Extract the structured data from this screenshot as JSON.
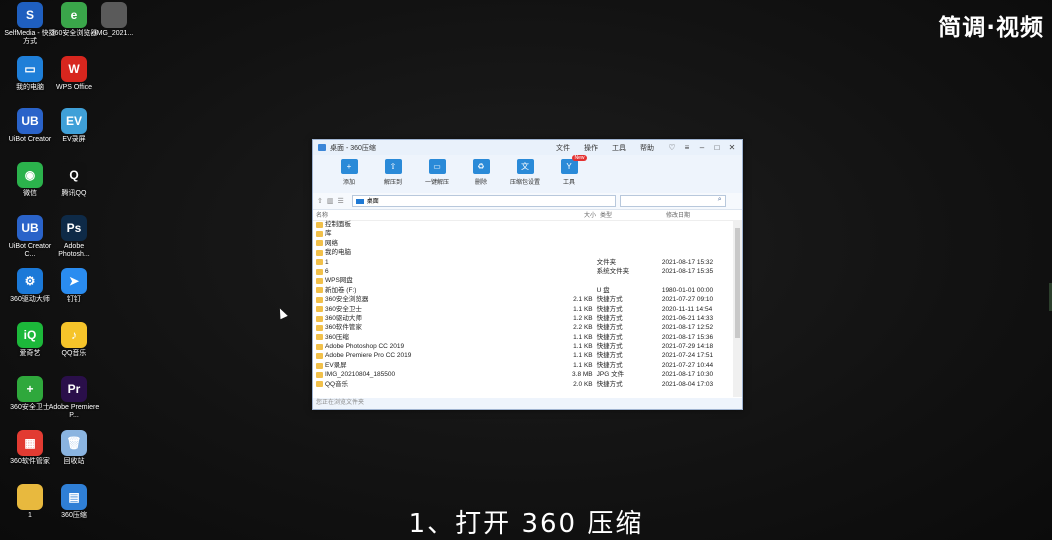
{
  "watermark": "简调·视频",
  "subtitle": "1、打开 360 压缩",
  "desktop_icons": [
    {
      "label": "SelfMedia - 快捷方式",
      "color": "#1f5fbf",
      "glyph": "S",
      "icon": "selfmedia-icon"
    },
    {
      "label": "360安全浏览器",
      "color": "#3aa64a",
      "glyph": "e",
      "icon": "browser-icon"
    },
    {
      "label": "IMG_2021...",
      "color": "#5a5a5a",
      "glyph": "",
      "icon": "image-thumbnail-icon"
    },
    {
      "label": "我的电脑",
      "color": "#1f7fd8",
      "glyph": "▭",
      "icon": "computer-icon"
    },
    {
      "label": "WPS Office",
      "color": "#d7261e",
      "glyph": "W",
      "icon": "wps-icon"
    },
    {
      "label": "UiBot Creator",
      "color": "#2a63c9",
      "glyph": "UB",
      "icon": "uibot-icon"
    },
    {
      "label": "EV录屏",
      "color": "#3fa0d8",
      "glyph": "EV",
      "icon": "ev-recorder-icon"
    },
    {
      "label": "微信",
      "color": "#2bb24c",
      "glyph": "◉",
      "icon": "wechat-icon"
    },
    {
      "label": "腾讯QQ",
      "color": "#111111",
      "glyph": "Q",
      "icon": "qq-icon"
    },
    {
      "label": "UiBot Creator C...",
      "color": "#2a63c9",
      "glyph": "UB",
      "icon": "uibot-icon"
    },
    {
      "label": "Adobe Photosh...",
      "color": "#0e2a47",
      "glyph": "Ps",
      "icon": "photoshop-icon"
    },
    {
      "label": "360驱动大师",
      "color": "#1b79d8",
      "glyph": "⚙",
      "icon": "driver-icon"
    },
    {
      "label": "钉钉",
      "color": "#2a8cf0",
      "glyph": "➤",
      "icon": "dingtalk-icon"
    },
    {
      "label": "爱奇艺",
      "color": "#1cb83a",
      "glyph": "iQ",
      "icon": "iqiyi-icon"
    },
    {
      "label": "QQ音乐",
      "color": "#f6c42a",
      "glyph": "♪",
      "icon": "qqmusic-icon"
    },
    {
      "label": "360安全卫士",
      "color": "#2fa83c",
      "glyph": "+",
      "icon": "security-icon"
    },
    {
      "label": "Adobe Premiere P...",
      "color": "#2a0f4a",
      "glyph": "Pr",
      "icon": "premiere-icon"
    },
    {
      "label": "360软件管家",
      "color": "#e23b32",
      "glyph": "▦",
      "icon": "software-manager-icon"
    },
    {
      "label": "回收站",
      "color": "#8ab4e0",
      "glyph": "🗑",
      "icon": "recycle-bin-icon"
    },
    {
      "label": "1",
      "color": "#e8b93e",
      "glyph": "",
      "icon": "folder-icon"
    },
    {
      "label": "360压缩",
      "color": "#2f7fd6",
      "glyph": "▤",
      "icon": "compress-icon"
    }
  ],
  "window": {
    "title": "桌面 - 360压缩",
    "menu": [
      "文件",
      "操作",
      "工具",
      "帮助"
    ],
    "toolbar": [
      {
        "label": "添加",
        "icon": "add-icon",
        "glyph": "+"
      },
      {
        "label": "解压到",
        "icon": "extract-to-icon",
        "glyph": "⇧"
      },
      {
        "label": "一键解压",
        "icon": "one-click-extract-icon",
        "glyph": "▭"
      },
      {
        "label": "删除",
        "icon": "delete-icon",
        "glyph": "♻"
      },
      {
        "label": "压缩包设置",
        "icon": "archive-settings-icon",
        "glyph": "文"
      },
      {
        "label": "工具",
        "icon": "tools-icon",
        "glyph": "Y",
        "badge": "New"
      }
    ],
    "address": "桌面",
    "columns": {
      "name": "名称",
      "size": "大小",
      "type": "类型",
      "date": "修改日期"
    },
    "rows": [
      {
        "name": "控制面板",
        "size": "",
        "type": "",
        "date": ""
      },
      {
        "name": "库",
        "size": "",
        "type": "",
        "date": ""
      },
      {
        "name": "网络",
        "size": "",
        "type": "",
        "date": ""
      },
      {
        "name": "我的电脑",
        "size": "",
        "type": "",
        "date": ""
      },
      {
        "name": "1",
        "size": "",
        "type": "文件夹",
        "date": "2021-08-17 15:32"
      },
      {
        "name": "6",
        "size": "",
        "type": "系统文件夹",
        "date": "2021-08-17 15:35"
      },
      {
        "name": "WPS网盘",
        "size": "",
        "type": "",
        "date": ""
      },
      {
        "name": "新加卷 (F:)",
        "size": "",
        "type": "U 盘",
        "date": "1980-01-01 00:00"
      },
      {
        "name": "360安全浏览器",
        "size": "2.1 KB",
        "type": "快捷方式",
        "date": "2021-07-27 09:10"
      },
      {
        "name": "360安全卫士",
        "size": "1.1 KB",
        "type": "快捷方式",
        "date": "2020-11-11 14:54"
      },
      {
        "name": "360驱动大师",
        "size": "1.2 KB",
        "type": "快捷方式",
        "date": "2021-06-21 14:33"
      },
      {
        "name": "360软件管家",
        "size": "2.2 KB",
        "type": "快捷方式",
        "date": "2021-08-17 12:52"
      },
      {
        "name": "360压缩",
        "size": "1.1 KB",
        "type": "快捷方式",
        "date": "2021-08-17 15:36"
      },
      {
        "name": "Adobe Photoshop CC 2019",
        "size": "1.1 KB",
        "type": "快捷方式",
        "date": "2021-07-29 14:18"
      },
      {
        "name": "Adobe Premiere Pro CC 2019",
        "size": "1.1 KB",
        "type": "快捷方式",
        "date": "2021-07-24 17:51"
      },
      {
        "name": "EV录屏",
        "size": "1.1 KB",
        "type": "快捷方式",
        "date": "2021-07-27 10:44"
      },
      {
        "name": "IMG_20210804_185500",
        "size": "3.8 MB",
        "type": "JPG 文件",
        "date": "2021-08-17 10:30"
      },
      {
        "name": "QQ音乐",
        "size": "2.0 KB",
        "type": "快捷方式",
        "date": "2021-08-04 17:03"
      }
    ],
    "status": "您正在浏览文件夹"
  }
}
